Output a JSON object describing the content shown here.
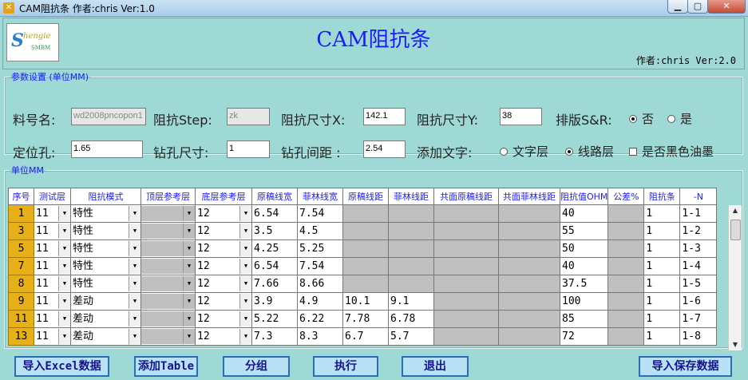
{
  "window": {
    "title": "CAM阻抗条 作者:chris  Ver:1.0",
    "min_glyph": "▁",
    "max_glyph": "▢",
    "close_glyph": "✕"
  },
  "header": {
    "app_title": "CAM阻抗条",
    "author": "作者:chris  Ver:2.0",
    "logo_text_1": "S",
    "logo_text_2": "hengie",
    "logo_text_3": "SMBM"
  },
  "params": {
    "legend": "参数设置 (单位MM)",
    "material_label": "料号名:",
    "material_value": "wd2008pncopon1",
    "step_label": "阻抗Step:",
    "step_value": "zk",
    "size_x_label": "阻抗尺寸X:",
    "size_x_value": "142.1",
    "size_y_label": "阻抗尺寸Y:",
    "size_y_value": "38",
    "snr_label": "排版S&R:",
    "snr_no": "否",
    "snr_yes": "是",
    "locate_label": "定位孔:",
    "locate_value": "1.65",
    "drill_size_label": "钻孔尺寸:",
    "drill_size_value": "1",
    "drill_pitch_label": "钻孔间距 :",
    "drill_pitch_value": "2.54",
    "addtext_label": "添加文字:",
    "text_layer": "文字层",
    "line_layer": "线路层",
    "black_ink": "是否黑色油墨"
  },
  "table": {
    "legend": "单位MM",
    "headers": [
      "序号",
      "测试层",
      "阻抗模式",
      "顶层参考层",
      "底层参考层",
      "原稿线宽",
      "菲林线宽",
      "原稿线距",
      "菲林线距",
      "共面原稿线距",
      "共面菲林线距",
      "阻抗值OHM",
      "公差%",
      "阻抗条",
      "-N"
    ],
    "rows": [
      {
        "seq": "1",
        "layer": "11",
        "mode": "特性",
        "bottom": "12",
        "w_orig": "6.54",
        "w_film": "7.54",
        "s_orig": "",
        "s_film": "",
        "ohm": "40",
        "tol": "",
        "strip": "1",
        "n": "1-1"
      },
      {
        "seq": "3",
        "layer": "11",
        "mode": "特性",
        "bottom": "12",
        "w_orig": "3.5",
        "w_film": "4.5",
        "s_orig": "",
        "s_film": "",
        "ohm": "55",
        "tol": "",
        "strip": "1",
        "n": "1-2"
      },
      {
        "seq": "5",
        "layer": "11",
        "mode": "特性",
        "bottom": "12",
        "w_orig": "4.25",
        "w_film": "5.25",
        "s_orig": "",
        "s_film": "",
        "ohm": "50",
        "tol": "",
        "strip": "1",
        "n": "1-3"
      },
      {
        "seq": "7",
        "layer": "11",
        "mode": "特性",
        "bottom": "12",
        "w_orig": "6.54",
        "w_film": "7.54",
        "s_orig": "",
        "s_film": "",
        "ohm": "40",
        "tol": "",
        "strip": "1",
        "n": "1-4"
      },
      {
        "seq": "8",
        "layer": "11",
        "mode": "特性",
        "bottom": "12",
        "w_orig": "7.66",
        "w_film": "8.66",
        "s_orig": "",
        "s_film": "",
        "ohm": "37.5",
        "tol": "",
        "strip": "1",
        "n": "1-5"
      },
      {
        "seq": "9",
        "layer": "11",
        "mode": "差动",
        "bottom": "12",
        "w_orig": "3.9",
        "w_film": "4.9",
        "s_orig": "10.1",
        "s_film": "9.1",
        "ohm": "100",
        "tol": "",
        "strip": "1",
        "n": "1-6"
      },
      {
        "seq": "11",
        "layer": "11",
        "mode": "差动",
        "bottom": "12",
        "w_orig": "5.22",
        "w_film": "6.22",
        "s_orig": "7.78",
        "s_film": "6.78",
        "ohm": "85",
        "tol": "",
        "strip": "1",
        "n": "1-7"
      },
      {
        "seq": "13",
        "layer": "11",
        "mode": "差动",
        "bottom": "12",
        "w_orig": "7.3",
        "w_film": "8.3",
        "s_orig": "6.7",
        "s_film": "5.7",
        "ohm": "72",
        "tol": "",
        "strip": "1",
        "n": "1-8"
      }
    ]
  },
  "buttons": {
    "import_excel": "导入Excel数据",
    "add_table": "添加Table",
    "group": "分组",
    "execute": "执行",
    "exit": "退出",
    "import_saved": "导入保存数据"
  },
  "colors": {
    "background": "#9fd9d6",
    "title_blue": "#1a1aff",
    "seq_gold": "#e7b016",
    "disabled_gray": "#c0c0c0"
  },
  "icons": {
    "app": "app-icon",
    "dropdown": "chevron-down-icon",
    "scroll_up": "arrow-up-icon",
    "scroll_down": "arrow-down-icon"
  }
}
